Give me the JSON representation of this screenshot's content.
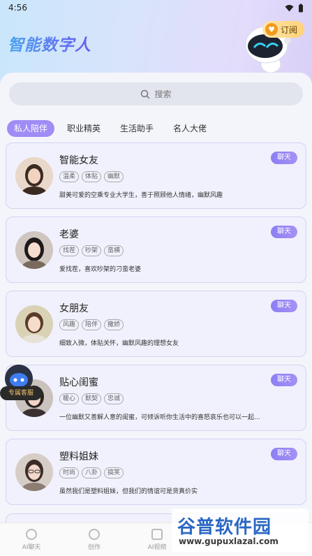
{
  "status_bar": {
    "time": "4:56"
  },
  "header": {
    "title": "智能数字人",
    "subscribe_label": "订阅"
  },
  "search": {
    "placeholder": "搜索"
  },
  "tabs": [
    {
      "label": "私人陪伴",
      "active": true
    },
    {
      "label": "职业精英",
      "active": false
    },
    {
      "label": "生活助手",
      "active": false
    },
    {
      "label": "名人大佬",
      "active": false
    }
  ],
  "chat_label": "聊天",
  "cards": [
    {
      "name": "智能女友",
      "tags": [
        "温柔",
        "体贴",
        "幽默"
      ],
      "desc": "甜美可爱的空乘专业大学生，善于照顾他人情绪，幽默风趣"
    },
    {
      "name": "老婆",
      "tags": [
        "找茬",
        "吵架",
        "蛮横"
      ],
      "desc": "爱找茬，喜欢吵架的刁蛮老婆"
    },
    {
      "name": "女朋友",
      "tags": [
        "风趣",
        "陪伴",
        "撒娇"
      ],
      "desc": "细致入微，体贴关怀，幽默风趣的理想女友"
    },
    {
      "name": "贴心闺蜜",
      "tags": [
        "暖心",
        "默契",
        "忠诚"
      ],
      "desc": "一位幽默又善解人意的闺蜜，可倾诉听你生活中的喜怒哀乐也可以一起..."
    },
    {
      "name": "塑料姐妹",
      "tags": [
        "时尚",
        "八卦",
        "搞笑"
      ],
      "desc": "虽然我们是塑料姐妹，但我们的情谊可是货真价实"
    }
  ],
  "service_label": "专属客服",
  "bottom_nav": [
    {
      "label": "AI聊天",
      "icon": "chat-icon"
    },
    {
      "label": "创作",
      "icon": "lightbulb-icon"
    },
    {
      "label": "AI视频",
      "icon": "video-icon"
    }
  ],
  "watermark": {
    "title": "谷普软件园",
    "url": "www.gupuxlazal.com"
  },
  "colors": {
    "accent": "#9f8cf5",
    "title_blue": "#4f6cf0",
    "card_bg": "#f1f1fd"
  }
}
